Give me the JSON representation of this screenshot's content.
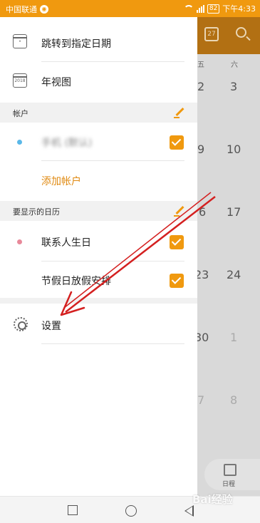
{
  "status_bar": {
    "carrier": "中国联通",
    "battery": "82",
    "time": "下午4:33"
  },
  "drawer": {
    "menu": [
      {
        "label": "跳转到指定日期",
        "icon": "calendar-jump-icon"
      },
      {
        "label": "年视图",
        "icon": "year-view-icon",
        "icon_text": "2018"
      }
    ],
    "accounts_section": {
      "title": "帐户",
      "account_label": "手机 (默认)",
      "account_color": "#5ab8e8",
      "add_account": "添加帐户"
    },
    "calendars_section": {
      "title": "要显示的日历",
      "items": [
        {
          "label": "联系人生日",
          "color": "#e8899a"
        },
        {
          "label": "节假日放假安排",
          "color": null
        }
      ]
    },
    "settings": {
      "label": "设置",
      "icon": "gear-icon"
    }
  },
  "calendar_bg": {
    "header_icon_date": "27",
    "weekdays": [
      "五",
      "六"
    ],
    "rows": [
      [
        "2",
        "3"
      ],
      [
        "9",
        "10"
      ],
      [
        "6",
        "17"
      ],
      [
        "23",
        "24"
      ],
      [
        "30",
        "1"
      ],
      [
        "7",
        "8"
      ]
    ],
    "tab_label": "日程"
  },
  "watermark": "Bai经验",
  "colors": {
    "accent": "#f0990f",
    "header_dim": "#b27013",
    "annotation_arrow": "#d42020"
  }
}
